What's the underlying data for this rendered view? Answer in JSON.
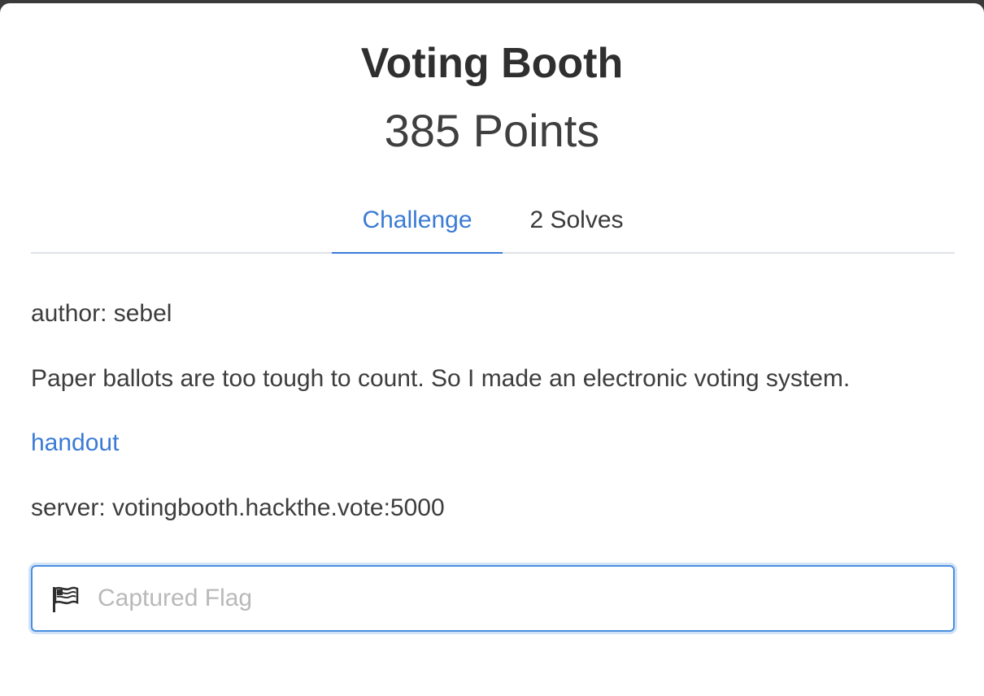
{
  "challenge": {
    "title": "Voting Booth",
    "points": "385 Points"
  },
  "tabs": [
    {
      "label": "Challenge",
      "active": true
    },
    {
      "label": "2 Solves",
      "active": false
    }
  ],
  "content": {
    "author": "author: sebel",
    "description": "Paper ballots are too tough to count. So I made an electronic voting system.",
    "handout_link": "handout",
    "server": "server: votingbooth.hackthe.vote:5000"
  },
  "flag_input": {
    "placeholder": "Captured Flag",
    "value": "",
    "icon": "flag-icon"
  },
  "colors": {
    "accent": "#3a7bd5",
    "focus_border": "#4a8fe0",
    "text": "#3d3d3d"
  }
}
